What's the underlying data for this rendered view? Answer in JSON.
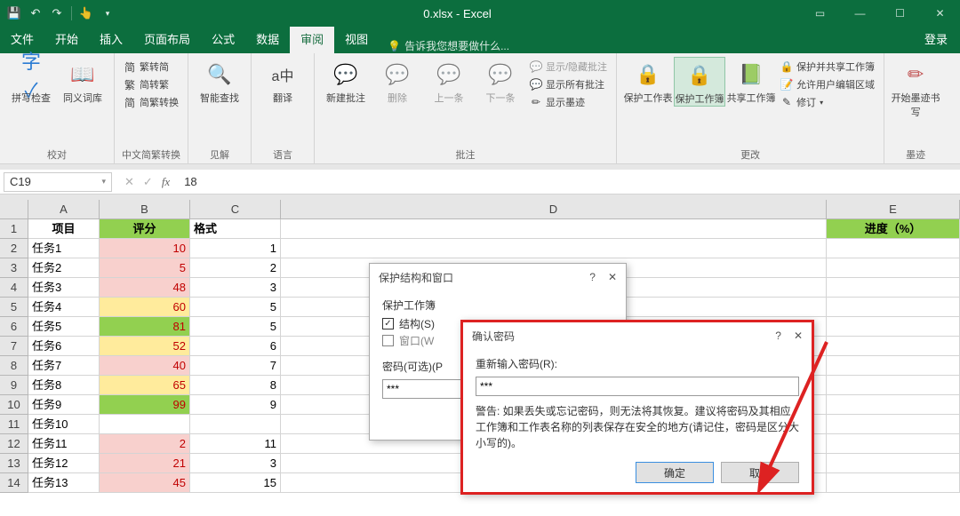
{
  "title": "0.xlsx - Excel",
  "tabs": [
    "文件",
    "开始",
    "插入",
    "页面布局",
    "公式",
    "数据",
    "审阅",
    "视图"
  ],
  "active_tab": "审阅",
  "tell_me": "告诉我您想要做什么...",
  "login": "登录",
  "ribbon": {
    "g1": {
      "btn1": "拼写检查",
      "btn2": "同义词库",
      "label": "校对"
    },
    "g2": {
      "i1": "繁转简",
      "i2": "简转繁",
      "i3": "简繁转换",
      "label": "中文简繁转换"
    },
    "g3": {
      "btn": "智能查找",
      "label": "见解"
    },
    "g4": {
      "btn": "翻译",
      "label": "语言"
    },
    "g5": {
      "b1": "新建批注",
      "b2": "删除",
      "b3": "上一条",
      "b4": "下一条",
      "i1": "显示/隐藏批注",
      "i2": "显示所有批注",
      "i3": "显示墨迹",
      "label": "批注"
    },
    "g6": {
      "b1": "保护工作表",
      "b2": "保护工作簿",
      "b3": "共享工作簿",
      "i1": "保护并共享工作簿",
      "i2": "允许用户编辑区域",
      "i3": "修订",
      "label": "更改"
    },
    "g7": {
      "b": "开始墨迹书写",
      "label": "墨迹"
    }
  },
  "namebox": "C19",
  "formula": "18",
  "columns": [
    "A",
    "B",
    "C",
    "D",
    "E"
  ],
  "headers": {
    "A": "项目",
    "B": "评分",
    "C": "格式",
    "E": "进度（%）"
  },
  "rows": [
    {
      "n": 1,
      "a": "项目",
      "b": "评分",
      "c": "格式",
      "bClass": "hdr-B",
      "aClass": "hdr-A",
      "header": true
    },
    {
      "n": 2,
      "a": "任务1",
      "b": "10",
      "c": "1",
      "bClass": "bg-pink"
    },
    {
      "n": 3,
      "a": "任务2",
      "b": "5",
      "c": "2",
      "bClass": "bg-pink"
    },
    {
      "n": 4,
      "a": "任务3",
      "b": "48",
      "c": "3",
      "bClass": "bg-pink"
    },
    {
      "n": 5,
      "a": "任务4",
      "b": "60",
      "c": "5",
      "bClass": "bg-yellow"
    },
    {
      "n": 6,
      "a": "任务5",
      "b": "81",
      "c": "5",
      "bClass": "bg-green"
    },
    {
      "n": 7,
      "a": "任务6",
      "b": "52",
      "c": "6",
      "bClass": "bg-yellow"
    },
    {
      "n": 8,
      "a": "任务7",
      "b": "40",
      "c": "7",
      "bClass": "bg-pink"
    },
    {
      "n": 9,
      "a": "任务8",
      "b": "65",
      "c": "8",
      "bClass": "bg-yellow"
    },
    {
      "n": 10,
      "a": "任务9",
      "b": "99",
      "c": "9",
      "bClass": "bg-green"
    },
    {
      "n": 11,
      "a": "任务10",
      "b": "",
      "c": "",
      "bClass": ""
    },
    {
      "n": 12,
      "a": "任务11",
      "b": "2",
      "c": "11",
      "bClass": "bg-pink"
    },
    {
      "n": 13,
      "a": "任务12",
      "b": "21",
      "c": "3",
      "bClass": "bg-pink"
    },
    {
      "n": 14,
      "a": "任务13",
      "b": "45",
      "c": "15",
      "bClass": "bg-pink"
    }
  ],
  "dlg1": {
    "title": "保护结构和窗口",
    "group": "保护工作簿",
    "chk1": "结构(S)",
    "chk2": "窗口(W",
    "pwd_label": "密码(可选)(P",
    "pwd_value": "***"
  },
  "dlg2": {
    "title": "确认密码",
    "help": "?",
    "close": "✕",
    "label": "重新输入密码(R):",
    "value": "***",
    "warn": "警告: 如果丢失或忘记密码，则无法将其恢复。建议将密码及其相应工作簿和工作表名称的列表保存在安全的地方(请记住，密码是区分大小写的)。",
    "ok": "确定",
    "cancel": "取消"
  }
}
